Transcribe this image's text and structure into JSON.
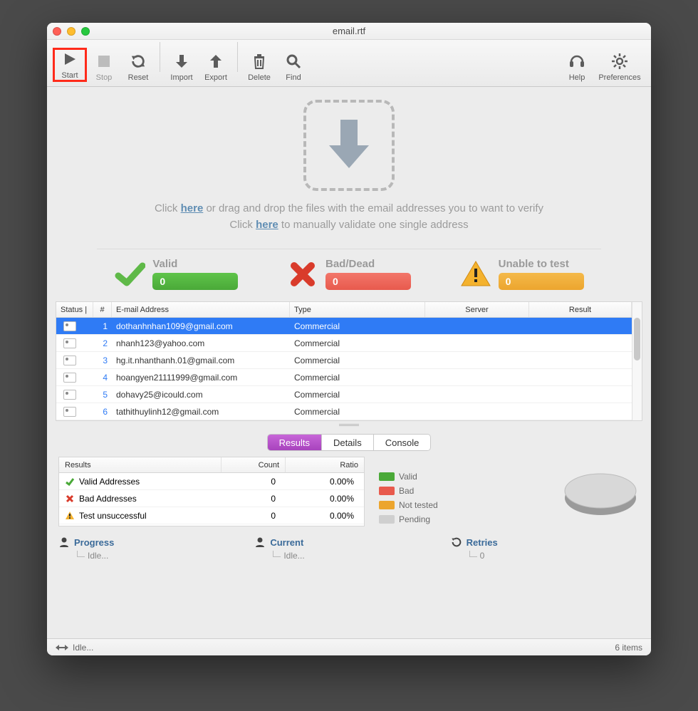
{
  "window": {
    "title": "email.rtf"
  },
  "toolbar": {
    "start": "Start",
    "stop": "Stop",
    "reset": "Reset",
    "import": "Import",
    "export": "Export",
    "delete": "Delete",
    "find": "Find",
    "help": "Help",
    "preferences": "Preferences"
  },
  "drop": {
    "line1_pre": "Click ",
    "line1_link": "here",
    "line1_post": " or drag and drop the files with the email addresses you to want to verify",
    "line2_pre": "Click ",
    "line2_link": "here",
    "line2_post": " to manually validate one single address"
  },
  "counters": {
    "valid": {
      "label": "Valid",
      "value": "0"
    },
    "bad": {
      "label": "Bad/Dead",
      "value": "0"
    },
    "unable": {
      "label": "Unable to test",
      "value": "0"
    }
  },
  "table": {
    "headers": {
      "status": "Status",
      "num": "#",
      "email": "E-mail Address",
      "type": "Type",
      "server": "Server",
      "result": "Result"
    },
    "rows": [
      {
        "num": "1",
        "email": "dothanhnhan1099@gmail.com",
        "type": "Commercial",
        "server": "",
        "result": "",
        "selected": true
      },
      {
        "num": "2",
        "email": "nhanh123@yahoo.com",
        "type": "Commercial",
        "server": "",
        "result": ""
      },
      {
        "num": "3",
        "email": "hg.it.nhanthanh.01@gmail.com",
        "type": "Commercial",
        "server": "",
        "result": ""
      },
      {
        "num": "4",
        "email": "hoangyen21111999@gmail.com",
        "type": "Commercial",
        "server": "",
        "result": ""
      },
      {
        "num": "5",
        "email": "dohavy25@icould.com",
        "type": "Commercial",
        "server": "",
        "result": ""
      },
      {
        "num": "6",
        "email": "tathithuylinh12@gmail.com",
        "type": "Commercial",
        "server": "",
        "result": ""
      }
    ]
  },
  "tabs": {
    "results": "Results",
    "details": "Details",
    "console": "Console"
  },
  "results_table": {
    "headers": {
      "results": "Results",
      "count": "Count",
      "ratio": "Ratio"
    },
    "rows": [
      {
        "label": "Valid Addresses",
        "count": "0",
        "ratio": "0.00%",
        "icon": "check"
      },
      {
        "label": "Bad Addresses",
        "count": "0",
        "ratio": "0.00%",
        "icon": "cross"
      },
      {
        "label": "Test unsuccessful",
        "count": "0",
        "ratio": "0.00%",
        "icon": "warn"
      }
    ]
  },
  "legend": {
    "valid": "Valid",
    "bad": "Bad",
    "nottested": "Not tested",
    "pending": "Pending"
  },
  "colors": {
    "valid": "#4aa938",
    "bad": "#e85a4d",
    "nottested": "#eca52e",
    "pending": "#cfcfcf"
  },
  "progress": {
    "progress": {
      "label": "Progress",
      "value": "Idle..."
    },
    "current": {
      "label": "Current",
      "value": "Idle..."
    },
    "retries": {
      "label": "Retries",
      "value": "0"
    }
  },
  "statusbar": {
    "left": "Idle...",
    "right": "6 items"
  }
}
